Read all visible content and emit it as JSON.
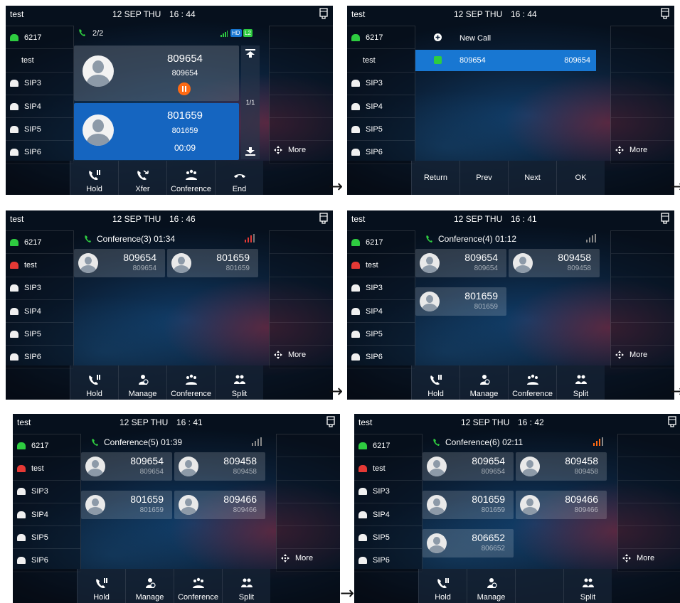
{
  "status": {
    "account": "test",
    "date": "12 SEP THU"
  },
  "lines": [
    "6217",
    "test",
    "SIP3",
    "SIP4",
    "SIP5",
    "SIP6"
  ],
  "more": "More",
  "arrow": "→",
  "p1": {
    "time": "16 : 44",
    "count": "2/2",
    "hd": "HD",
    "l2": "L2",
    "call1": {
      "name": "809654",
      "number": "809654"
    },
    "call2": {
      "name": "801659",
      "number": "801659",
      "duration": "00:09"
    },
    "page": "1/1",
    "softkeys": [
      "Hold",
      "Xfer",
      "Conference",
      "End"
    ]
  },
  "p2": {
    "time": "16 : 44",
    "new_call": "New Call",
    "selected": {
      "name": "809654",
      "number": "809654"
    },
    "softkeys": [
      "Return",
      "Prev",
      "Next",
      "OK"
    ]
  },
  "p3": {
    "time": "16 : 46",
    "title": "Conference(3)",
    "duration": "01:34",
    "tiles": [
      [
        "809654",
        "809654"
      ],
      [
        "801659",
        "801659"
      ]
    ],
    "softkeys": [
      "Hold",
      "Manage",
      "Conference",
      "Split"
    ]
  },
  "p4": {
    "time": "16 : 41",
    "title": "Conference(4)",
    "duration": "01:12",
    "tiles": [
      [
        "809654",
        "809654"
      ],
      [
        "809458",
        "809458"
      ],
      [
        "801659",
        "801659"
      ]
    ],
    "softkeys": [
      "Hold",
      "Manage",
      "Conference",
      "Split"
    ]
  },
  "p5": {
    "time": "16 : 41",
    "title": "Conference(5)",
    "duration": "01:39",
    "tiles": [
      [
        "809654",
        "809654"
      ],
      [
        "809458",
        "809458"
      ],
      [
        "801659",
        "801659"
      ],
      [
        "809466",
        "809466"
      ]
    ],
    "softkeys": [
      "Hold",
      "Manage",
      "Conference",
      "Split"
    ]
  },
  "p6": {
    "time": "16 : 42",
    "title": "Conference(6)",
    "duration": "02:11",
    "tiles": [
      [
        "809654",
        "809654"
      ],
      [
        "809458",
        "809458"
      ],
      [
        "801659",
        "801659"
      ],
      [
        "809466",
        "809466"
      ],
      [
        "806652",
        "806652"
      ]
    ],
    "softkeys": [
      "Hold",
      "Manage",
      "",
      "Split"
    ]
  },
  "colors": {
    "active_call": "#1565c0",
    "selection": "#1877d2",
    "green": "#2ecc40",
    "hold": "#ff6a13",
    "red_line": "#e53935"
  }
}
